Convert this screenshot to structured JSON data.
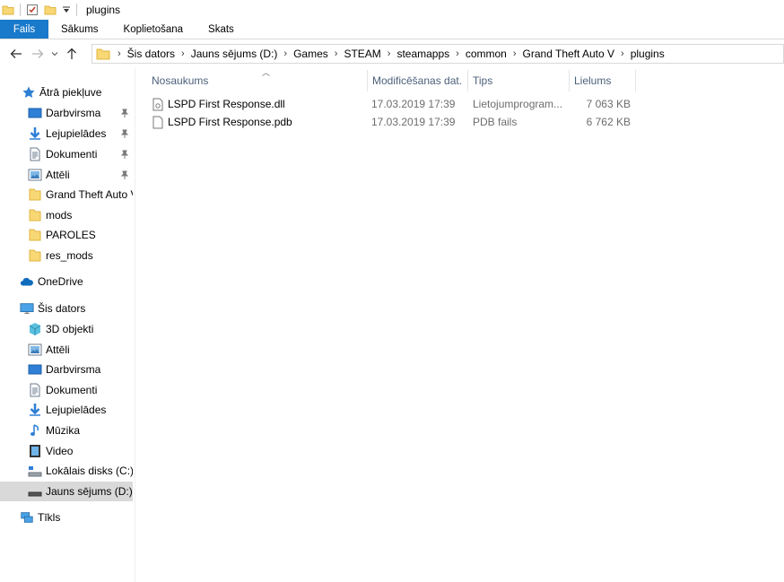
{
  "window": {
    "title": "plugins"
  },
  "ribbon": {
    "tabs": [
      "Fails",
      "Sākums",
      "Koplietošana",
      "Skats"
    ]
  },
  "address": {
    "crumbs": [
      "Šis dators",
      "Jauns sējums (D:)",
      "Games",
      "STEAM",
      "steamapps",
      "common",
      "Grand Theft Auto V",
      "plugins"
    ]
  },
  "navpane": {
    "quick_access": {
      "label": "Ātrā piekļuve"
    },
    "pinned": [
      {
        "label": "Darbvirsma",
        "icon": "desktop-icon"
      },
      {
        "label": "Lejupielādes",
        "icon": "download-icon"
      },
      {
        "label": "Dokumenti",
        "icon": "document-icon"
      },
      {
        "label": "Attēli",
        "icon": "pictures-icon"
      }
    ],
    "recent": [
      {
        "label": "Grand Theft Auto V",
        "icon": "folder-icon"
      },
      {
        "label": "mods",
        "icon": "folder-icon"
      },
      {
        "label": "PAROLES",
        "icon": "folder-icon"
      },
      {
        "label": "res_mods",
        "icon": "folder-icon"
      }
    ],
    "onedrive": {
      "label": "OneDrive"
    },
    "this_pc": {
      "label": "Šis dators"
    },
    "pc_items": [
      {
        "label": "3D objekti",
        "icon": "3d-objects-icon"
      },
      {
        "label": "Attēli",
        "icon": "pictures-icon"
      },
      {
        "label": "Darbvirsma",
        "icon": "desktop-icon"
      },
      {
        "label": "Dokumenti",
        "icon": "document-icon"
      },
      {
        "label": "Lejupielādes",
        "icon": "download-icon"
      },
      {
        "label": "Mūzika",
        "icon": "music-icon"
      },
      {
        "label": "Video",
        "icon": "video-icon"
      },
      {
        "label": "Lokālais disks (C:)",
        "icon": "system-drive-icon"
      },
      {
        "label": "Jauns sējums (D:)",
        "icon": "drive-icon"
      }
    ],
    "network": {
      "label": "Tīkls"
    }
  },
  "details": {
    "columns": [
      "Nosaukums",
      "Modificēšanas dat.",
      "Tips",
      "Lielums"
    ],
    "files": [
      {
        "name": "LSPD First Response.dll",
        "modified": "17.03.2019 17:39",
        "type": "Lietojumprogram...",
        "size": "7 063 KB",
        "icon": "dll-file-icon"
      },
      {
        "name": "LSPD First Response.pdb",
        "modified": "17.03.2019 17:39",
        "type": "PDB fails",
        "size": "6 762 KB",
        "icon": "file-icon"
      }
    ]
  },
  "colors": {
    "accent": "#1979ca",
    "header_text": "#4c607a",
    "selection": "#d9d9d9"
  }
}
